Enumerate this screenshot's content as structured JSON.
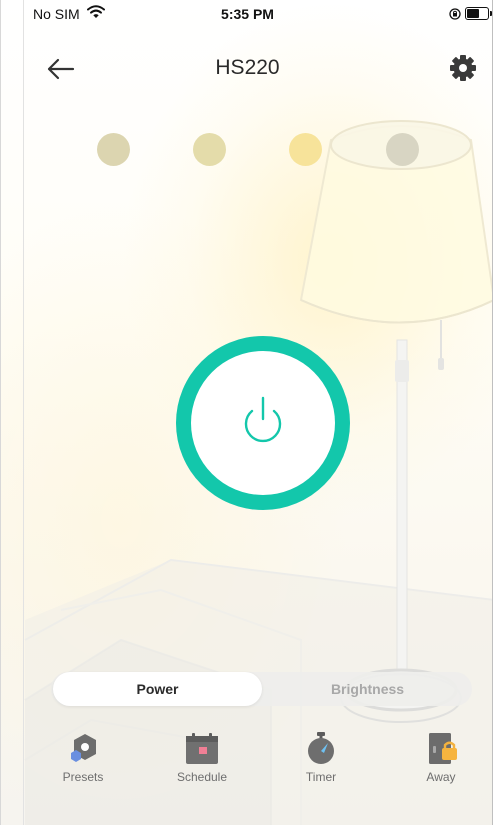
{
  "status_bar": {
    "carrier": "No SIM",
    "time": "5:35 PM"
  },
  "header": {
    "title": "HS220",
    "back_icon": "arrow-left-icon",
    "settings_icon": "gear-icon"
  },
  "scene_presets": [
    {
      "color": "#dcd5b0"
    },
    {
      "color": "#e4dcaa"
    },
    {
      "color": "#f7e39a"
    },
    {
      "color": "#d8d5c3"
    }
  ],
  "power_button": {
    "icon": "power-icon",
    "accent": "#13c7ab"
  },
  "tabs": [
    {
      "label": "Power",
      "active": true
    },
    {
      "label": "Brightness",
      "active": false
    }
  ],
  "bottom_nav": [
    {
      "label": "Presets",
      "icon": "presets-icon"
    },
    {
      "label": "Schedule",
      "icon": "calendar-icon"
    },
    {
      "label": "Timer",
      "icon": "stopwatch-icon"
    },
    {
      "label": "Away",
      "icon": "away-lock-icon"
    }
  ]
}
